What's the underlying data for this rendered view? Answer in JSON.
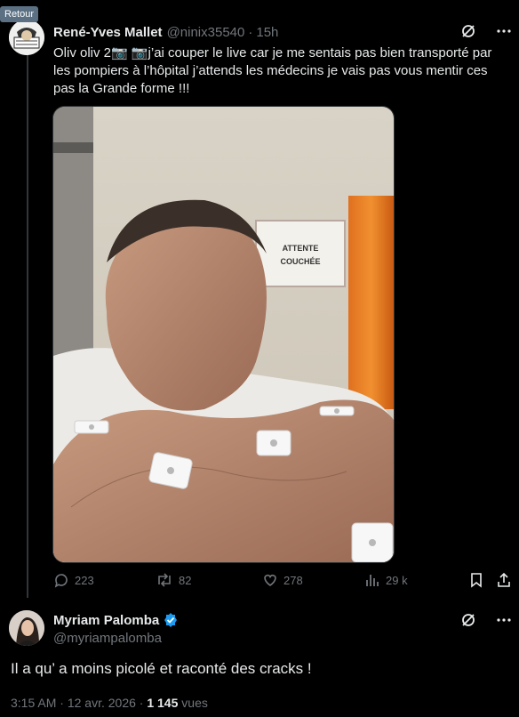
{
  "tooltip": "Retour",
  "post1": {
    "author_name": "René-Yves Mallet",
    "handle": "@ninix35540",
    "separator": "·",
    "time": "15h",
    "text": "Oliv oliv 2📷 📷j’ai couper le live car je me sentais pas bien transporté par les pompiers à l’hôpital j’attends les médecins je vais pas vous mentir ces pas la Grande forme !!!",
    "sign_text_1": "ATTENTE",
    "sign_text_2": "COUCHÉE",
    "stats": {
      "replies": "223",
      "reposts": "82",
      "likes": "278",
      "views": "29 k"
    }
  },
  "post2": {
    "author_name": "Myriam Palomba",
    "handle": "@myriampalomba",
    "text": "Il a qu’ a moins picolé et raconté des cracks !",
    "time": "3:15 AM",
    "separator": "·",
    "date": "12 avr. 2026",
    "views_count": "1 145",
    "views_label": "vues"
  },
  "colors": {
    "background": "#000000",
    "text": "#e7e9ea",
    "muted": "#71767b",
    "verified": "#1d9bf0"
  }
}
